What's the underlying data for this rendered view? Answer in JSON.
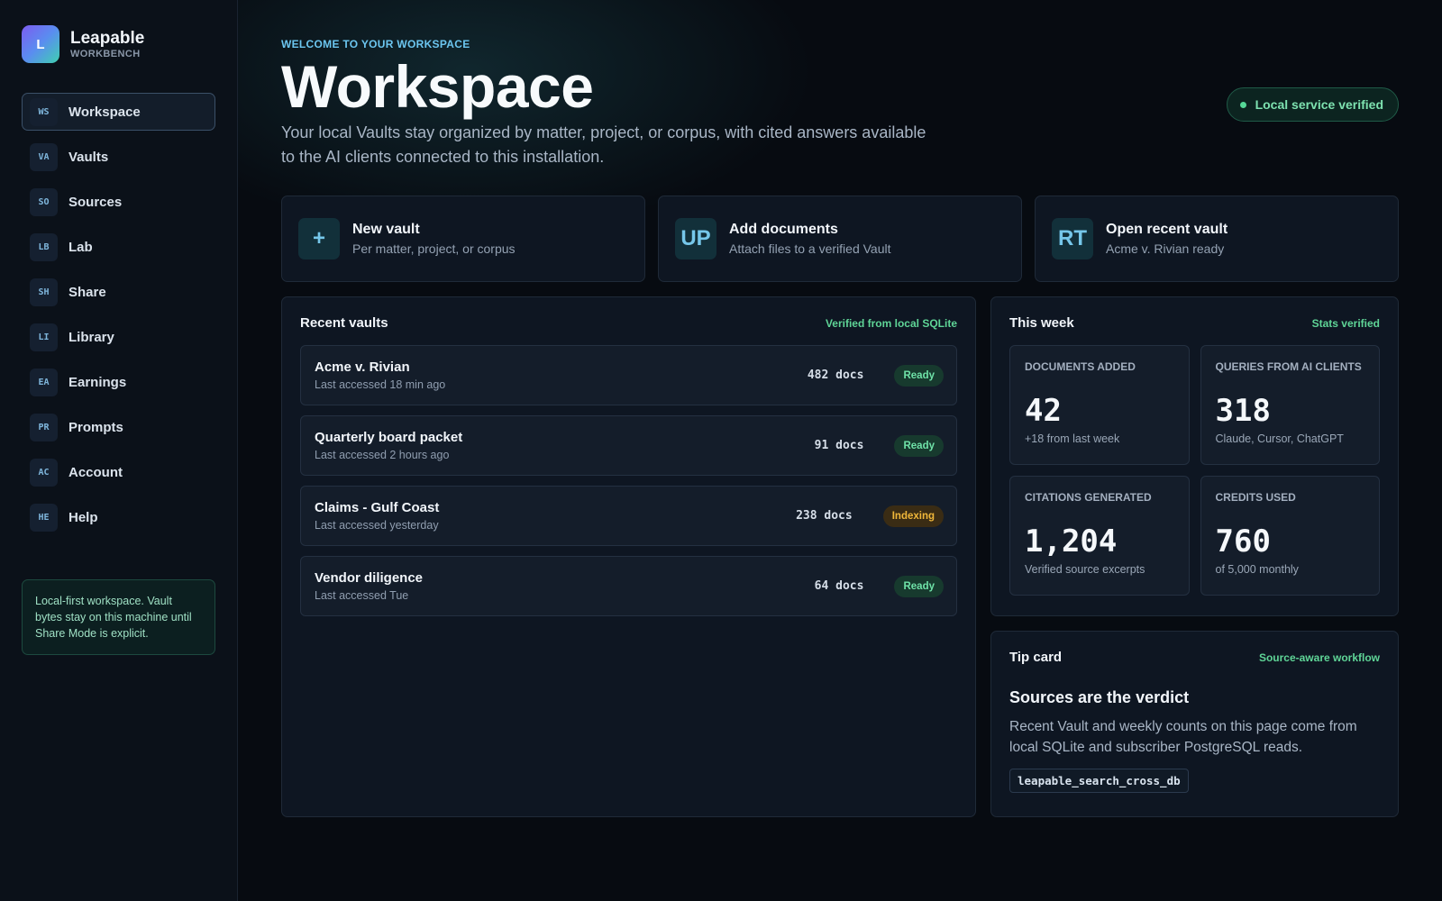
{
  "brand": {
    "logo": "L",
    "name": "Leapable",
    "sub": "WORKBENCH"
  },
  "nav": [
    {
      "code": "WS",
      "label": "Workspace"
    },
    {
      "code": "VA",
      "label": "Vaults"
    },
    {
      "code": "SO",
      "label": "Sources"
    },
    {
      "code": "LB",
      "label": "Lab"
    },
    {
      "code": "SH",
      "label": "Share"
    },
    {
      "code": "LI",
      "label": "Library"
    },
    {
      "code": "EA",
      "label": "Earnings"
    },
    {
      "code": "PR",
      "label": "Prompts"
    },
    {
      "code": "AC",
      "label": "Account"
    },
    {
      "code": "HE",
      "label": "Help"
    }
  ],
  "side_note": "Local-first workspace. Vault bytes stay on this machine until Share Mode is explicit.",
  "header": {
    "eyebrow": "WELCOME TO YOUR WORKSPACE",
    "title": "Workspace",
    "description": "Your local Vaults stay organized by matter, project, or corpus, with cited answers available to the AI clients connected to this installation.",
    "status": "Local service verified"
  },
  "actions": [
    {
      "icon": "+",
      "title": "New vault",
      "sub": "Per matter, project, or corpus"
    },
    {
      "icon": "UP",
      "title": "Add documents",
      "sub": "Attach files to a verified Vault"
    },
    {
      "icon": "RT",
      "title": "Open recent vault",
      "sub": "Acme v. Rivian ready"
    }
  ],
  "recent": {
    "title": "Recent vaults",
    "tag": "Verified from local SQLite",
    "rows": [
      {
        "name": "Acme v. Rivian",
        "meta": "Last accessed 18 min ago",
        "docs": "482 docs",
        "status": "Ready"
      },
      {
        "name": "Quarterly board packet",
        "meta": "Last accessed 2 hours ago",
        "docs": "91 docs",
        "status": "Ready"
      },
      {
        "name": "Claims - Gulf Coast",
        "meta": "Last accessed yesterday",
        "docs": "238 docs",
        "status": "Indexing"
      },
      {
        "name": "Vendor diligence",
        "meta": "Last accessed Tue",
        "docs": "64 docs",
        "status": "Ready"
      }
    ]
  },
  "week": {
    "title": "This week",
    "tag": "Stats verified",
    "stats": [
      {
        "label": "DOCUMENTS ADDED",
        "value": "42",
        "note": "+18 from last week"
      },
      {
        "label": "QUERIES FROM AI CLIENTS",
        "value": "318",
        "note": "Claude, Cursor, ChatGPT"
      },
      {
        "label": "CITATIONS GENERATED",
        "value": "1,204",
        "note": "Verified source excerpts"
      },
      {
        "label": "CREDITS USED",
        "value": "760",
        "note": "of 5,000 monthly"
      }
    ]
  },
  "tip": {
    "title": "Tip card",
    "tag": "Source-aware workflow",
    "heading": "Sources are the verdict",
    "body": "Recent Vault and weekly counts on this page come from local SQLite and subscriber PostgreSQL reads.",
    "code": "leapable_search_cross_db"
  },
  "colors": {
    "accent": "#6cc6f0",
    "success": "#5fd597",
    "warning": "#f0b73a",
    "background": "#070b11"
  }
}
